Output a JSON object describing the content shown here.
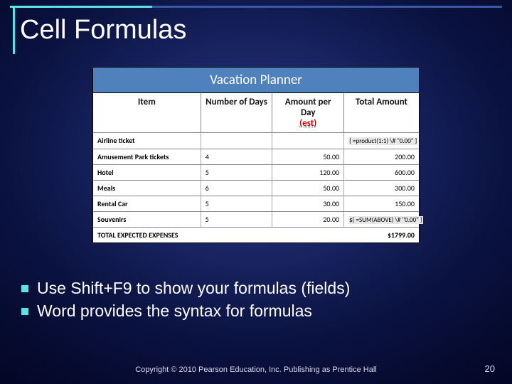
{
  "title": "Cell Formulas",
  "planner": {
    "caption": "Vacation Planner",
    "headers": {
      "item": "Item",
      "days": "Number of Days",
      "amount_line1": "Amount per Day",
      "amount_est": "(est)",
      "total": "Total Amount"
    },
    "rows": [
      {
        "item": "Airline ticket",
        "days": "",
        "amount": "",
        "total_is_field": true,
        "total": "{  =product(1:1) \\# \"0.00\"  }"
      },
      {
        "item": "Amusement Park tickets",
        "days": "4",
        "amount": "50.00",
        "total_is_field": false,
        "total": "200.00"
      },
      {
        "item": "Hotel",
        "days": "5",
        "amount": "120.00",
        "total_is_field": false,
        "total": "600.00"
      },
      {
        "item": "Meals",
        "days": "6",
        "amount": "50.00",
        "total_is_field": false,
        "total": "300.00"
      },
      {
        "item": "Rental Car",
        "days": "5",
        "amount": "30.00",
        "total_is_field": false,
        "total": "150.00"
      },
      {
        "item": "Souvenirs",
        "days": "5",
        "amount": "20.00",
        "total_is_field": true,
        "total": "${ =SUM(ABOVE) \\# \"0.00\" }"
      }
    ],
    "total_row": {
      "label": "TOTAL EXPECTED EXPENSES",
      "value": "$1799.00"
    }
  },
  "bullets": [
    "Use Shift+F9 to show your formulas (fields)",
    "Word provides the syntax for formulas"
  ],
  "footer": {
    "copyright": "Copyright © 2010 Pearson Education, Inc. Publishing as Prentice Hall",
    "page": "20"
  },
  "chart_data": {
    "type": "table",
    "title": "Vacation Planner",
    "columns": [
      "Item",
      "Number of Days",
      "Amount per Day (est)",
      "Total Amount"
    ],
    "rows": [
      [
        "Airline ticket",
        null,
        null,
        "{ =product(1:1) \\# \"0.00\" }"
      ],
      [
        "Amusement Park tickets",
        4,
        50.0,
        200.0
      ],
      [
        "Hotel",
        5,
        120.0,
        600.0
      ],
      [
        "Meals",
        6,
        50.0,
        300.0
      ],
      [
        "Rental Car",
        5,
        30.0,
        150.0
      ],
      [
        "Souvenirs",
        5,
        20.0,
        "${ =SUM(ABOVE) \\# \"0.00\" }"
      ]
    ],
    "footer": [
      "TOTAL EXPECTED EXPENSES",
      "$1799.00"
    ]
  }
}
